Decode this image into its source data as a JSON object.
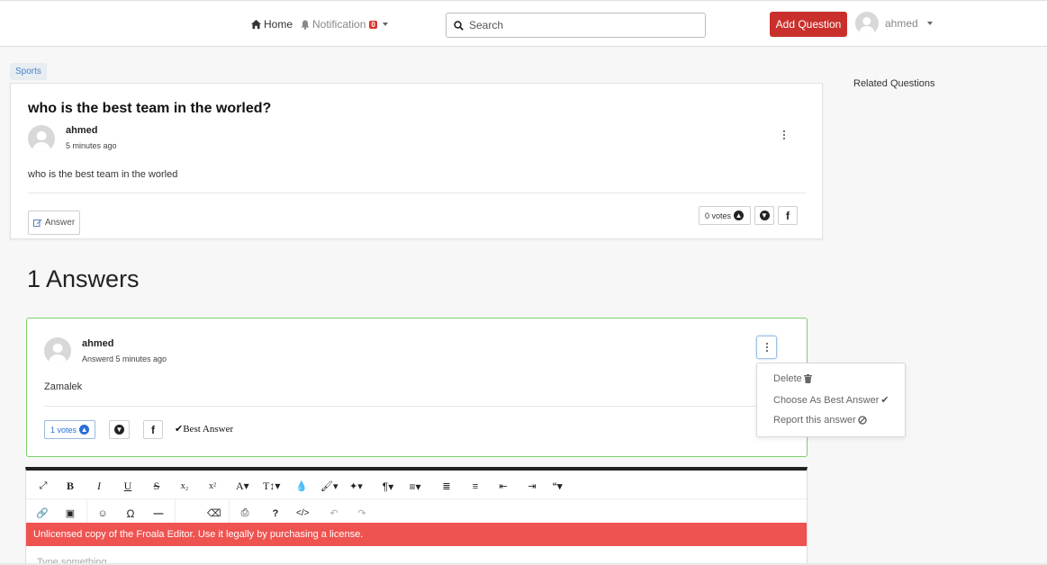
{
  "nav": {
    "home_label": "Home",
    "notifications_label": "Notification",
    "notifications_count": "0",
    "search_placeholder": "Search",
    "add_question_label": "Add Question",
    "user_name": "ahmed"
  },
  "question": {
    "category": "Sports",
    "title": "who is the best team in the worled?",
    "author": "ahmed",
    "time": "5 minutes ago",
    "body": "who is the best team in the worled",
    "answer_button_label": "Answer",
    "votes_label": "0 votes"
  },
  "answers_heading": "1 Answers",
  "answers": [
    {
      "author": "ahmed",
      "time": "Answerd 5 minutes ago",
      "body": "Zamalek",
      "votes_label": "1 votes",
      "best_answer_label": "Best Answer"
    }
  ],
  "answer_menu": {
    "delete_label": "Delete",
    "best_label": "Choose As Best Answer",
    "report_label": "Report this answer"
  },
  "editor": {
    "license_message": "Unlicensed copy of the Froala Editor. Use it legally by purchasing a license.",
    "placeholder": "Type something"
  },
  "sidebar": {
    "related_title": "Related Questions"
  },
  "colors": {
    "primary_red": "#c9302c",
    "accepted_border": "#7dd16b",
    "vote_blue": "#2a6fd8",
    "license_bar": "#ee5350"
  }
}
